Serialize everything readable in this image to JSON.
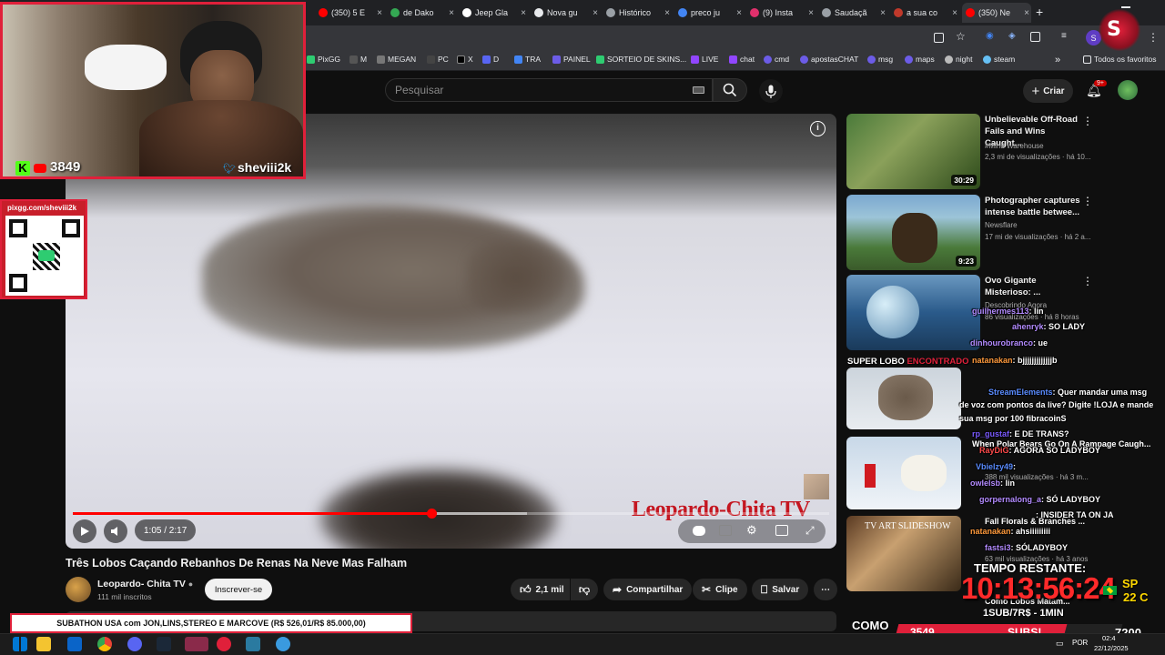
{
  "browser": {
    "tabs": [
      {
        "label": "(350) 5 E",
        "color": "#ff0000"
      },
      {
        "label": "de Dako",
        "color": "#34a853"
      },
      {
        "label": "Jeep Gla",
        "color": "#ffffff"
      },
      {
        "label": "Nova gu",
        "color": "#e8eaed"
      },
      {
        "label": "Histórico",
        "color": "#9aa0a6"
      },
      {
        "label": "preco ju",
        "color": "#4285f4"
      },
      {
        "label": "(9) Insta",
        "color": "#e1306c"
      },
      {
        "label": "Saudaçã",
        "color": "#9aa0a6"
      },
      {
        "label": "a sua co",
        "color": "#c0392b"
      },
      {
        "label": "(350) Ne",
        "color": "#ff0000"
      }
    ],
    "new_tab": "+",
    "bookmarks": [
      {
        "label": "PixGG",
        "color": "#2ecc71"
      },
      {
        "label": "M",
        "color": "#555"
      },
      {
        "label": "MEGAN",
        "color": "#777"
      },
      {
        "label": "PC",
        "color": "#444"
      },
      {
        "label": "X",
        "color": "#000"
      },
      {
        "label": "X",
        "color": "#000"
      },
      {
        "label": "D",
        "color": "#5865f2"
      },
      {
        "label": "TRA",
        "color": "#4285f4"
      },
      {
        "label": "PAINEL",
        "color": "#6c5ce7"
      },
      {
        "label": "SORTEIO DE SKINS...",
        "color": "#2ecc71"
      },
      {
        "label": "LIVE",
        "color": "#9146ff"
      },
      {
        "label": "chat",
        "color": "#9146ff"
      },
      {
        "label": "cmd",
        "color": "#6c5ce7"
      },
      {
        "label": "apostasCHAT",
        "color": "#6c5ce7"
      },
      {
        "label": "msg",
        "color": "#6c5ce7"
      },
      {
        "label": "maps",
        "color": "#6c5ce7"
      },
      {
        "label": "night",
        "color": "#bbb"
      },
      {
        "label": "steam",
        "color": "#1b2838"
      }
    ],
    "all_bookmarks": "Todos os favoritos"
  },
  "youtube": {
    "search_placeholder": "Pesquisar",
    "create_label": "Criar",
    "notif_count": "9+",
    "video": {
      "title": "Três Lobos Caçando Rebanhos De Renas Na Neve Mas Falham",
      "time": "1:05 / 2:17",
      "progress": 0.474,
      "buffer": 0.6,
      "watermark": "Leopardo-Chita TV",
      "channel": "Leopardo- Chita TV",
      "subs": "111 mil inscritos",
      "subscribe": "Inscrever-se",
      "likes": "2,1 mil",
      "share": "Compartilhar",
      "clip": "Clipe",
      "save": "Salvar"
    },
    "recommended": [
      {
        "title": "Unbelievable Off-Road Fails and Wins Caught...",
        "channel": "#Mind Warehouse",
        "meta": "2,3 mi de visualizações · há 10...",
        "duration": "30:29"
      },
      {
        "title": "Photographer captures intense battle betwee...",
        "channel": "Newsflare",
        "meta": "17 mi de visualizações · há 2 a...",
        "duration": "9:23"
      },
      {
        "title": "Ovo Gigante Misterioso: ...",
        "channel": "Descobrindo Agora",
        "meta": "86 visualizações · há 8 horas",
        "duration": ""
      }
    ]
  },
  "stream": {
    "kick_count": "3849",
    "handle": "sheviii2k",
    "pix_url": "pixgg.com/sheviii2k",
    "banner": "SUBATHON USA com JON,LINS,STEREO E MARCOVE (R$ 526,01/R$ 85.000,00)",
    "super_lobo": "SUPER LOBO",
    "encontrado": "ENCONTRADO",
    "tempo_label": "TEMPO RESTANTE:",
    "timer": "10:13:56:24",
    "location": "SP",
    "temperature": "22 C",
    "sub_rate": "1SUB/7R$ - 1MIN",
    "como": "COMO",
    "subs_count": "3549",
    "subs_label": "SUBS!",
    "goal": "7200",
    "chat": [
      {
        "user": "guilhermes113",
        "msg": ": lin"
      },
      {
        "user": "ahenryk",
        "msg": ": SO LADY"
      },
      {
        "user": "dinhourobranco",
        "msg": ": ue"
      },
      {
        "user": "natanakan",
        "msg": ": bjjjjjjjjjjjjjb"
      },
      {
        "user": "StreamElements",
        "msg": ": Quer mandar uma msg"
      },
      {
        "user": "",
        "msg": "de voz com pontos da live? Digite !LOJA e mande"
      },
      {
        "user": "",
        "msg": "sua msg por 100 fibracoinS"
      },
      {
        "user": "rp_gustaf",
        "msg": ": E DE TRANS?"
      },
      {
        "user": "RayDiG",
        "msg": ": AGORA SO LADYBOY"
      },
      {
        "user": "Vbielzy49",
        "msg": ":"
      },
      {
        "user": "owlelsb",
        "msg": ": lin"
      },
      {
        "user": "gorpernalong_a",
        "msg": ": SÓ LADYBOY"
      },
      {
        "user": "",
        "msg": ": INSIDER TA ON JA"
      },
      {
        "user": "natanakan",
        "msg": ": ahsiiiiiiiii"
      },
      {
        "user": "fastsi3",
        "msg": ": SÓLADYBOY"
      }
    ]
  },
  "overlay_videos": [
    {
      "title": "When Polar Bears Go On A Rampage Caugh...",
      "meta": "388 mil visualizações · há 3 m..."
    },
    {
      "title": "Fall Florals & Branches ...",
      "meta": "63 mil visualizações · há 3 anos"
    },
    {
      "title": "Como Lobos Matam...",
      "meta": ""
    }
  ],
  "taskbar": {
    "lang": "POR",
    "time": "02:4",
    "date": "22/12/2025"
  }
}
